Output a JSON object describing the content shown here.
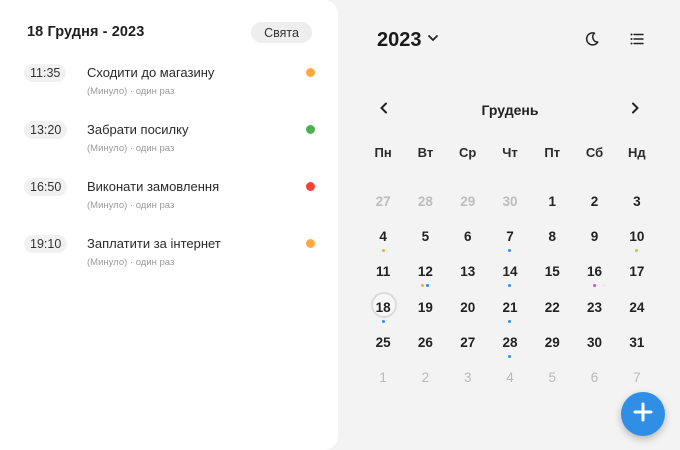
{
  "day_panel": {
    "title": "18 Грудня - 2023",
    "holidays_label": "Свята",
    "events": [
      {
        "time": "11:35",
        "title": "Сходити до магазину",
        "subtitle": "(Минуло) · один раз",
        "color": "#ffa940"
      },
      {
        "time": "13:20",
        "title": "Забрати посилку",
        "subtitle": "(Минуло) · один раз",
        "color": "#4caf50"
      },
      {
        "time": "16:50",
        "title": "Виконати замовлення",
        "subtitle": "(Минуло) · один раз",
        "color": "#f44336"
      },
      {
        "time": "19:10",
        "title": "Заплатити за інтернет",
        "subtitle": "(Минуло) · один раз",
        "color": "#ffa940"
      }
    ]
  },
  "calendar": {
    "year": "2023",
    "month": "Грудень",
    "weekdays": [
      "Пн",
      "Вт",
      "Ср",
      "Чт",
      "Пт",
      "Сб",
      "Нд"
    ],
    "weeks": [
      [
        {
          "d": "27",
          "o": "prev"
        },
        {
          "d": "28",
          "o": "prev"
        },
        {
          "d": "29",
          "o": "prev"
        },
        {
          "d": "30",
          "o": "prev"
        },
        {
          "d": "1"
        },
        {
          "d": "2"
        },
        {
          "d": "3"
        }
      ],
      [
        {
          "d": "4",
          "dots": [
            "#ffa940"
          ]
        },
        {
          "d": "5"
        },
        {
          "d": "6"
        },
        {
          "d": "7",
          "dots": [
            "#2f8fe6"
          ]
        },
        {
          "d": "8"
        },
        {
          "d": "9"
        },
        {
          "d": "10",
          "dots": [
            "#ffa940"
          ]
        }
      ],
      [
        {
          "d": "11"
        },
        {
          "d": "12",
          "dots": [
            "#ffa940",
            "#2f8fe6"
          ]
        },
        {
          "d": "13"
        },
        {
          "d": "14",
          "dots": [
            "#2f8fe6"
          ]
        },
        {
          "d": "15"
        },
        {
          "d": "16",
          "dots": [
            "#e040fb"
          ]
        },
        {
          "d": "17"
        }
      ],
      [
        {
          "d": "18",
          "today": true,
          "dots": [
            "#2f8fe6"
          ]
        },
        {
          "d": "19"
        },
        {
          "d": "20"
        },
        {
          "d": "21",
          "dots": [
            "#2f8fe6"
          ]
        },
        {
          "d": "22"
        },
        {
          "d": "23"
        },
        {
          "d": "24"
        }
      ],
      [
        {
          "d": "25"
        },
        {
          "d": "26"
        },
        {
          "d": "27"
        },
        {
          "d": "28",
          "dots": [
            "#2f8fe6"
          ]
        },
        {
          "d": "29"
        },
        {
          "d": "30"
        },
        {
          "d": "31"
        }
      ],
      [
        {
          "d": "1",
          "o": "next"
        },
        {
          "d": "2",
          "o": "next"
        },
        {
          "d": "3",
          "o": "next"
        },
        {
          "d": "4",
          "o": "next"
        },
        {
          "d": "5",
          "o": "next"
        },
        {
          "d": "6",
          "o": "next"
        },
        {
          "d": "7",
          "o": "next"
        }
      ]
    ]
  },
  "colors": {
    "accent": "#2f8fe6",
    "panel_bg": "#ffffff",
    "page_bg": "#f3f3f3"
  },
  "icons": {
    "year_dropdown": "chevron-down-icon",
    "theme": "moon-icon",
    "view": "list-icon",
    "prev_month": "chevron-left-icon",
    "next_month": "chevron-right-icon",
    "add": "plus-icon"
  }
}
